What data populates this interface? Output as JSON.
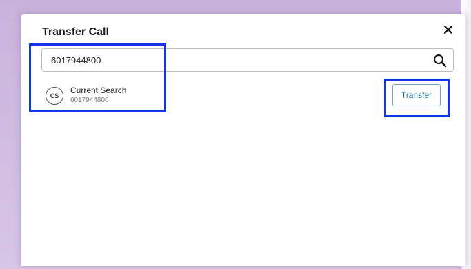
{
  "dialog": {
    "title": "Transfer Call",
    "close_icon": "close-icon"
  },
  "search": {
    "value": "6017944800",
    "icon": "search-icon"
  },
  "results": [
    {
      "avatar_initials": "CS",
      "name": "Current Search",
      "number": "6017944800"
    }
  ],
  "actions": {
    "transfer_label": "Transfer"
  },
  "colors": {
    "highlight": "#1036e6",
    "transfer_text": "#1f6f94",
    "backdrop": "#c9b3dc"
  }
}
